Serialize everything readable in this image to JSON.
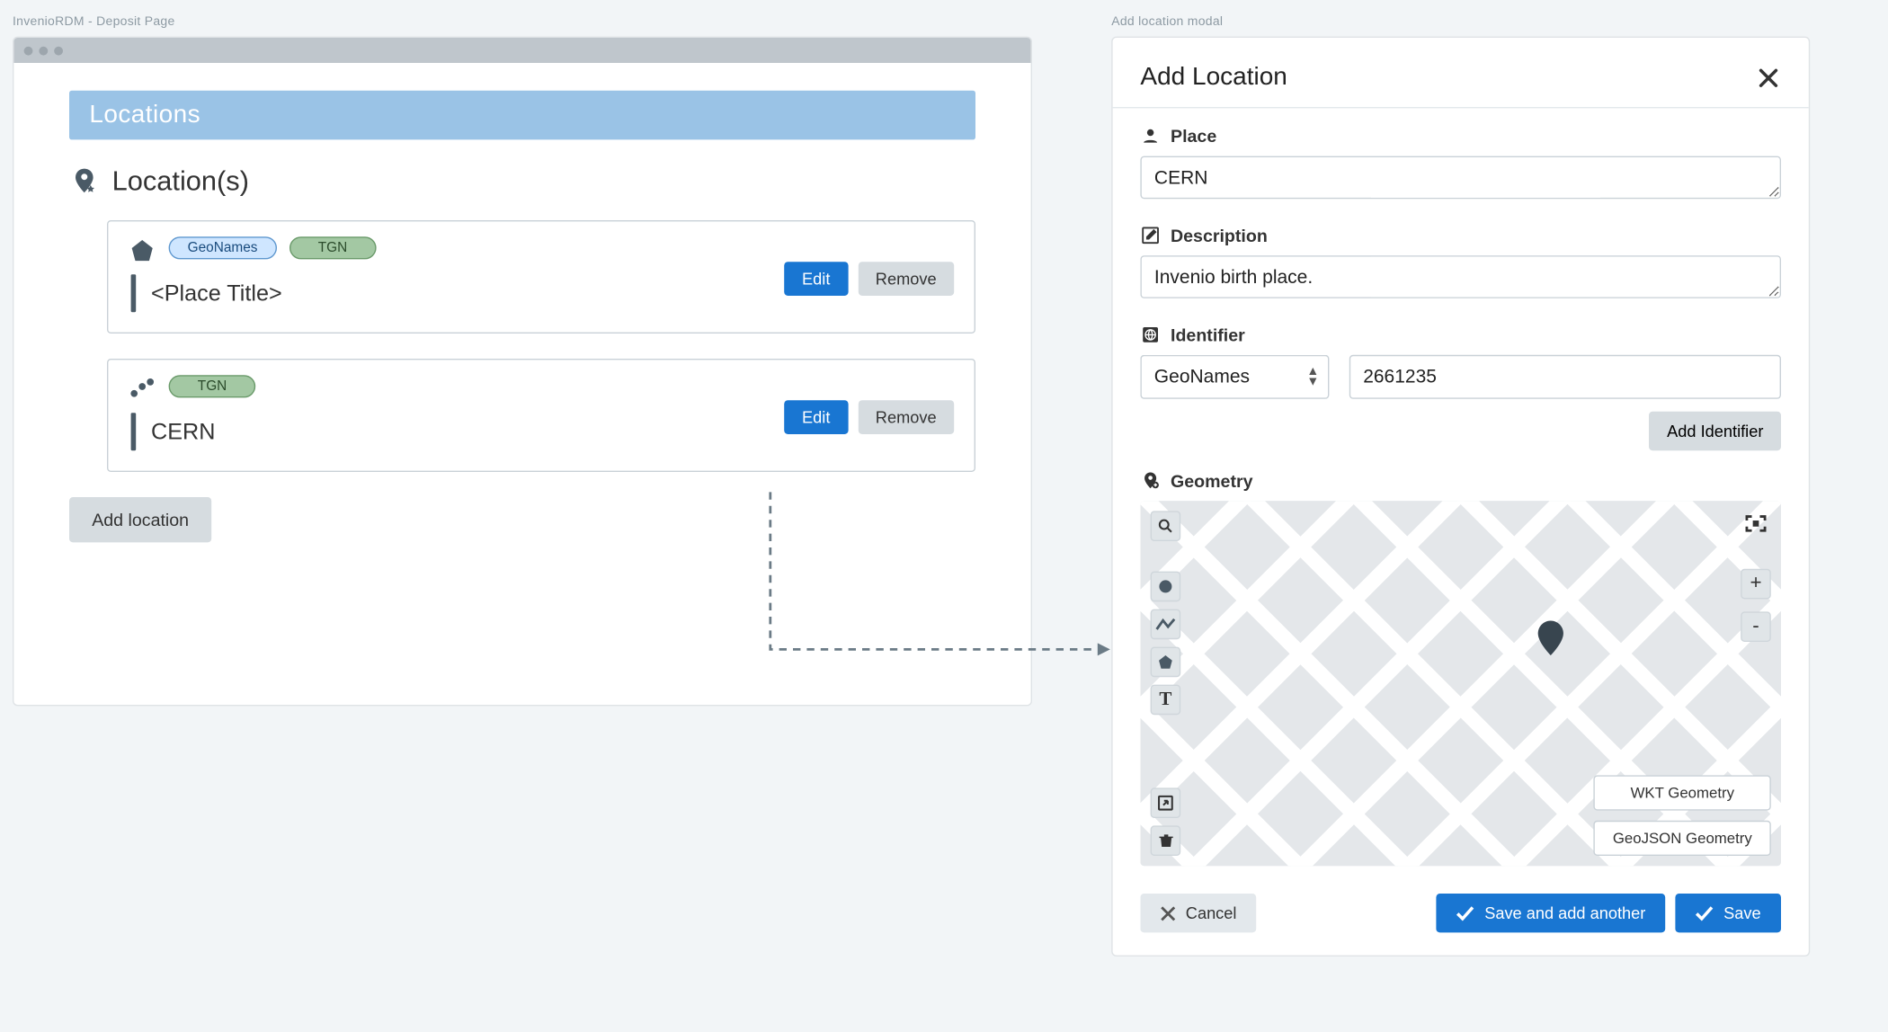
{
  "left": {
    "caption": "InvenioRDM - Deposit Page",
    "banner": "Locations",
    "section_title": "Location(s)",
    "cards": [
      {
        "title": "<Place Title>",
        "tags": [
          "GeoNames",
          "TGN"
        ],
        "edit": "Edit",
        "remove": "Remove"
      },
      {
        "title": "CERN",
        "tags": [
          "TGN"
        ],
        "edit": "Edit",
        "remove": "Remove"
      }
    ],
    "add_location": "Add location"
  },
  "right": {
    "caption": "Add location modal",
    "title": "Add Location",
    "place_label": "Place",
    "place_value": "CERN",
    "description_label": "Description",
    "description_value": "Invenio birth place.",
    "identifier_label": "Identifier",
    "identifier_scheme": "GeoNames",
    "identifier_value": "2661235",
    "add_identifier": "Add Identifier",
    "geometry_label": "Geometry",
    "wkt_btn": "WKT Geometry",
    "geojson_btn": "GeoJSON Geometry",
    "zoom_in": "+",
    "zoom_out": "-",
    "cancel": "Cancel",
    "save_add_another": "Save and add another",
    "save": "Save"
  }
}
